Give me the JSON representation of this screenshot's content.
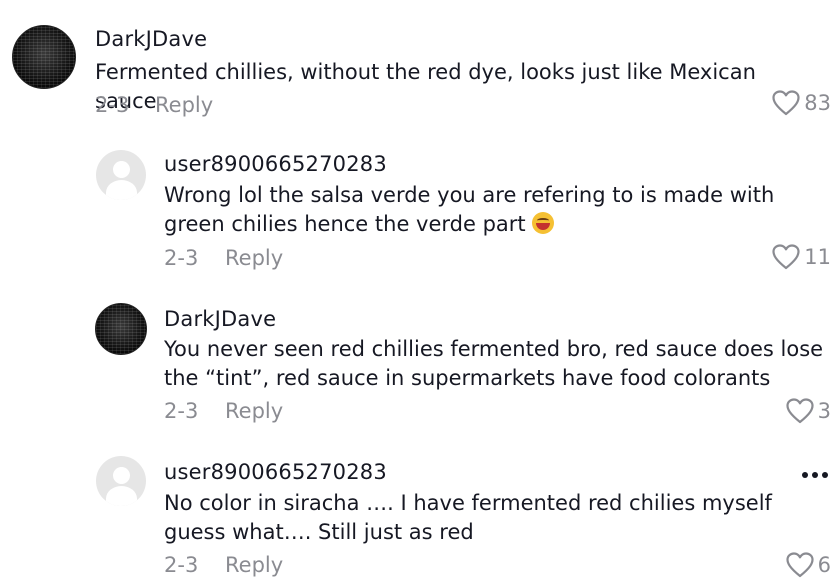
{
  "comments": [
    {
      "username": "DarkJDave",
      "text": "Fermented chillies, without the red dye, looks just like Mexican sauce",
      "date": "2-3",
      "reply_label": "Reply",
      "likes": "83",
      "avatar": "dark-pattern-avatar"
    },
    {
      "username": "user8900665270283",
      "text": "Wrong lol the salsa verde you are refering to is made with green chilies hence the verde part",
      "emoji": "laughing-tears-emoji",
      "date": "2-3",
      "reply_label": "Reply",
      "likes": "11",
      "avatar": "default-user-avatar"
    },
    {
      "username": "DarkJDave",
      "text": "You never seen red chillies fermented bro, red sauce does lose the “tint”, red sauce in supermarkets have food colorants",
      "date": "2-3",
      "reply_label": "Reply",
      "likes": "3",
      "avatar": "dark-pattern-avatar"
    },
    {
      "username": "user8900665270283",
      "text": "No color in siracha …. I have fermented red chilies myself guess what…. Still just as red",
      "date": "2-3",
      "reply_label": "Reply",
      "likes": "6",
      "avatar": "default-user-avatar",
      "more_icon": "more-options-icon"
    }
  ],
  "colors": {
    "text": "#161823",
    "secondary": "#8a8b91",
    "background": "#ffffff"
  }
}
